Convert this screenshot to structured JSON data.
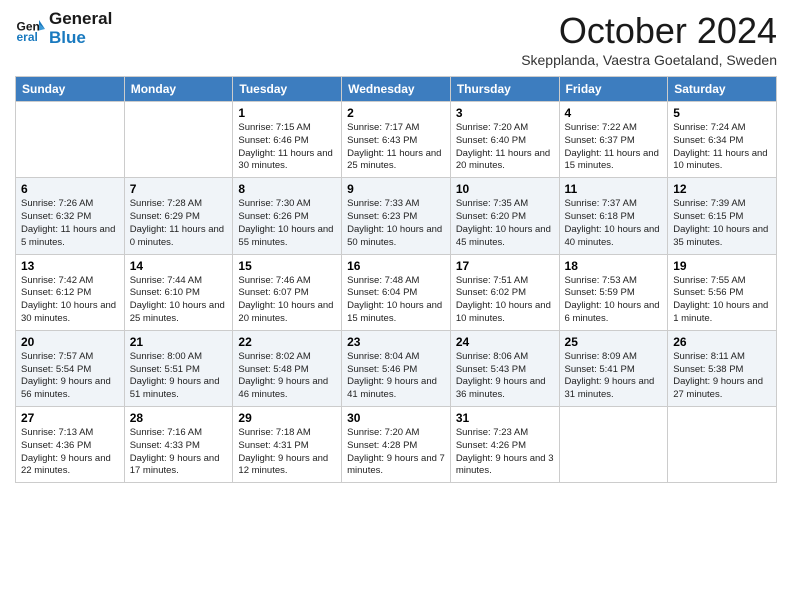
{
  "header": {
    "logo_line1": "General",
    "logo_line2": "Blue",
    "month": "October 2024",
    "location": "Skepplanda, Vaestra Goetaland, Sweden"
  },
  "days_of_week": [
    "Sunday",
    "Monday",
    "Tuesday",
    "Wednesday",
    "Thursday",
    "Friday",
    "Saturday"
  ],
  "weeks": [
    [
      {
        "day": "",
        "sunrise": "",
        "sunset": "",
        "daylight": ""
      },
      {
        "day": "",
        "sunrise": "",
        "sunset": "",
        "daylight": ""
      },
      {
        "day": "1",
        "sunrise": "Sunrise: 7:15 AM",
        "sunset": "Sunset: 6:46 PM",
        "daylight": "Daylight: 11 hours and 30 minutes."
      },
      {
        "day": "2",
        "sunrise": "Sunrise: 7:17 AM",
        "sunset": "Sunset: 6:43 PM",
        "daylight": "Daylight: 11 hours and 25 minutes."
      },
      {
        "day": "3",
        "sunrise": "Sunrise: 7:20 AM",
        "sunset": "Sunset: 6:40 PM",
        "daylight": "Daylight: 11 hours and 20 minutes."
      },
      {
        "day": "4",
        "sunrise": "Sunrise: 7:22 AM",
        "sunset": "Sunset: 6:37 PM",
        "daylight": "Daylight: 11 hours and 15 minutes."
      },
      {
        "day": "5",
        "sunrise": "Sunrise: 7:24 AM",
        "sunset": "Sunset: 6:34 PM",
        "daylight": "Daylight: 11 hours and 10 minutes."
      }
    ],
    [
      {
        "day": "6",
        "sunrise": "Sunrise: 7:26 AM",
        "sunset": "Sunset: 6:32 PM",
        "daylight": "Daylight: 11 hours and 5 minutes."
      },
      {
        "day": "7",
        "sunrise": "Sunrise: 7:28 AM",
        "sunset": "Sunset: 6:29 PM",
        "daylight": "Daylight: 11 hours and 0 minutes."
      },
      {
        "day": "8",
        "sunrise": "Sunrise: 7:30 AM",
        "sunset": "Sunset: 6:26 PM",
        "daylight": "Daylight: 10 hours and 55 minutes."
      },
      {
        "day": "9",
        "sunrise": "Sunrise: 7:33 AM",
        "sunset": "Sunset: 6:23 PM",
        "daylight": "Daylight: 10 hours and 50 minutes."
      },
      {
        "day": "10",
        "sunrise": "Sunrise: 7:35 AM",
        "sunset": "Sunset: 6:20 PM",
        "daylight": "Daylight: 10 hours and 45 minutes."
      },
      {
        "day": "11",
        "sunrise": "Sunrise: 7:37 AM",
        "sunset": "Sunset: 6:18 PM",
        "daylight": "Daylight: 10 hours and 40 minutes."
      },
      {
        "day": "12",
        "sunrise": "Sunrise: 7:39 AM",
        "sunset": "Sunset: 6:15 PM",
        "daylight": "Daylight: 10 hours and 35 minutes."
      }
    ],
    [
      {
        "day": "13",
        "sunrise": "Sunrise: 7:42 AM",
        "sunset": "Sunset: 6:12 PM",
        "daylight": "Daylight: 10 hours and 30 minutes."
      },
      {
        "day": "14",
        "sunrise": "Sunrise: 7:44 AM",
        "sunset": "Sunset: 6:10 PM",
        "daylight": "Daylight: 10 hours and 25 minutes."
      },
      {
        "day": "15",
        "sunrise": "Sunrise: 7:46 AM",
        "sunset": "Sunset: 6:07 PM",
        "daylight": "Daylight: 10 hours and 20 minutes."
      },
      {
        "day": "16",
        "sunrise": "Sunrise: 7:48 AM",
        "sunset": "Sunset: 6:04 PM",
        "daylight": "Daylight: 10 hours and 15 minutes."
      },
      {
        "day": "17",
        "sunrise": "Sunrise: 7:51 AM",
        "sunset": "Sunset: 6:02 PM",
        "daylight": "Daylight: 10 hours and 10 minutes."
      },
      {
        "day": "18",
        "sunrise": "Sunrise: 7:53 AM",
        "sunset": "Sunset: 5:59 PM",
        "daylight": "Daylight: 10 hours and 6 minutes."
      },
      {
        "day": "19",
        "sunrise": "Sunrise: 7:55 AM",
        "sunset": "Sunset: 5:56 PM",
        "daylight": "Daylight: 10 hours and 1 minute."
      }
    ],
    [
      {
        "day": "20",
        "sunrise": "Sunrise: 7:57 AM",
        "sunset": "Sunset: 5:54 PM",
        "daylight": "Daylight: 9 hours and 56 minutes."
      },
      {
        "day": "21",
        "sunrise": "Sunrise: 8:00 AM",
        "sunset": "Sunset: 5:51 PM",
        "daylight": "Daylight: 9 hours and 51 minutes."
      },
      {
        "day": "22",
        "sunrise": "Sunrise: 8:02 AM",
        "sunset": "Sunset: 5:48 PM",
        "daylight": "Daylight: 9 hours and 46 minutes."
      },
      {
        "day": "23",
        "sunrise": "Sunrise: 8:04 AM",
        "sunset": "Sunset: 5:46 PM",
        "daylight": "Daylight: 9 hours and 41 minutes."
      },
      {
        "day": "24",
        "sunrise": "Sunrise: 8:06 AM",
        "sunset": "Sunset: 5:43 PM",
        "daylight": "Daylight: 9 hours and 36 minutes."
      },
      {
        "day": "25",
        "sunrise": "Sunrise: 8:09 AM",
        "sunset": "Sunset: 5:41 PM",
        "daylight": "Daylight: 9 hours and 31 minutes."
      },
      {
        "day": "26",
        "sunrise": "Sunrise: 8:11 AM",
        "sunset": "Sunset: 5:38 PM",
        "daylight": "Daylight: 9 hours and 27 minutes."
      }
    ],
    [
      {
        "day": "27",
        "sunrise": "Sunrise: 7:13 AM",
        "sunset": "Sunset: 4:36 PM",
        "daylight": "Daylight: 9 hours and 22 minutes."
      },
      {
        "day": "28",
        "sunrise": "Sunrise: 7:16 AM",
        "sunset": "Sunset: 4:33 PM",
        "daylight": "Daylight: 9 hours and 17 minutes."
      },
      {
        "day": "29",
        "sunrise": "Sunrise: 7:18 AM",
        "sunset": "Sunset: 4:31 PM",
        "daylight": "Daylight: 9 hours and 12 minutes."
      },
      {
        "day": "30",
        "sunrise": "Sunrise: 7:20 AM",
        "sunset": "Sunset: 4:28 PM",
        "daylight": "Daylight: 9 hours and 7 minutes."
      },
      {
        "day": "31",
        "sunrise": "Sunrise: 7:23 AM",
        "sunset": "Sunset: 4:26 PM",
        "daylight": "Daylight: 9 hours and 3 minutes."
      },
      {
        "day": "",
        "sunrise": "",
        "sunset": "",
        "daylight": ""
      },
      {
        "day": "",
        "sunrise": "",
        "sunset": "",
        "daylight": ""
      }
    ]
  ]
}
